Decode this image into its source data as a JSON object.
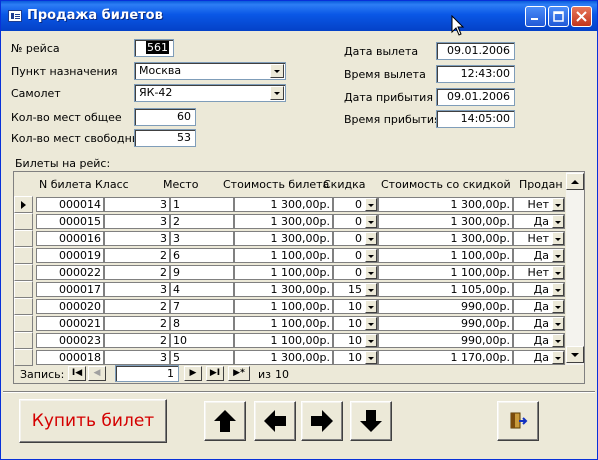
{
  "window": {
    "title": "Продажа билетов"
  },
  "flight": {
    "number_label": "№ рейса",
    "number_value": "561",
    "destination_label": "Пункт назначения",
    "destination_value": "Москва",
    "plane_label": "Самолет",
    "plane_value": "ЯК-42",
    "seats_total_label": "Кол-во мест общее",
    "seats_total_value": "60",
    "seats_free_label": "Кол-во мест свободных",
    "seats_free_value": "53",
    "dep_date_label": "Дата вылета",
    "dep_date_value": "09.01.2006",
    "dep_time_label": "Время вылета",
    "dep_time_value": "12:43:00",
    "arr_date_label": "Дата прибытия",
    "arr_date_value": "09.01.2006",
    "arr_time_label": "Время прибытия",
    "arr_time_value": "14:05:00"
  },
  "tickets": {
    "section_label": "Билеты на рейс:",
    "columns": {
      "ticket": "N билета",
      "class": "Класс",
      "seat": "Место",
      "price": "Стоимость билета",
      "discount": "Скидка",
      "price_discount": "Стоимость со скидкой",
      "sold": "Продан"
    },
    "rows": [
      {
        "ticket": "000014",
        "class": "3",
        "seat": "1",
        "price": "1 300,00р.",
        "discount": "0",
        "price_discount": "1 300,00р.",
        "sold": "Нет"
      },
      {
        "ticket": "000015",
        "class": "3",
        "seat": "2",
        "price": "1 300,00р.",
        "discount": "0",
        "price_discount": "1 300,00р.",
        "sold": "Да"
      },
      {
        "ticket": "000016",
        "class": "3",
        "seat": "3",
        "price": "1 300,00р.",
        "discount": "0",
        "price_discount": "1 300,00р.",
        "sold": "Нет"
      },
      {
        "ticket": "000019",
        "class": "2",
        "seat": "6",
        "price": "1 100,00р.",
        "discount": "0",
        "price_discount": "1 100,00р.",
        "sold": "Да"
      },
      {
        "ticket": "000022",
        "class": "2",
        "seat": "9",
        "price": "1 100,00р.",
        "discount": "0",
        "price_discount": "1 100,00р.",
        "sold": "Нет"
      },
      {
        "ticket": "000017",
        "class": "3",
        "seat": "4",
        "price": "1 300,00р.",
        "discount": "15",
        "price_discount": "1 105,00р.",
        "sold": "Да"
      },
      {
        "ticket": "000020",
        "class": "2",
        "seat": "7",
        "price": "1 100,00р.",
        "discount": "10",
        "price_discount": "990,00р.",
        "sold": "Да"
      },
      {
        "ticket": "000021",
        "class": "2",
        "seat": "8",
        "price": "1 100,00р.",
        "discount": "10",
        "price_discount": "990,00р.",
        "sold": "Да"
      },
      {
        "ticket": "000023",
        "class": "2",
        "seat": "10",
        "price": "1 100,00р.",
        "discount": "10",
        "price_discount": "990,00р.",
        "sold": "Да"
      },
      {
        "ticket": "000018",
        "class": "3",
        "seat": "5",
        "price": "1 300,00р.",
        "discount": "10",
        "price_discount": "1 170,00р.",
        "sold": "Да"
      }
    ]
  },
  "navigation": {
    "record_label": "Запись:",
    "current_record": "1",
    "of_label": "из",
    "total_records": "10",
    "first_symbol": "I◀",
    "prev_symbol": "◀",
    "next_symbol": "▶",
    "last_symbol": "▶I",
    "new_symbol": "▶*"
  },
  "actions": {
    "buy_label": "Купить билет"
  },
  "colors": {
    "title_bar": "#0a57e6",
    "buy_text": "#d40000",
    "window_bg": "#ece9d8"
  }
}
